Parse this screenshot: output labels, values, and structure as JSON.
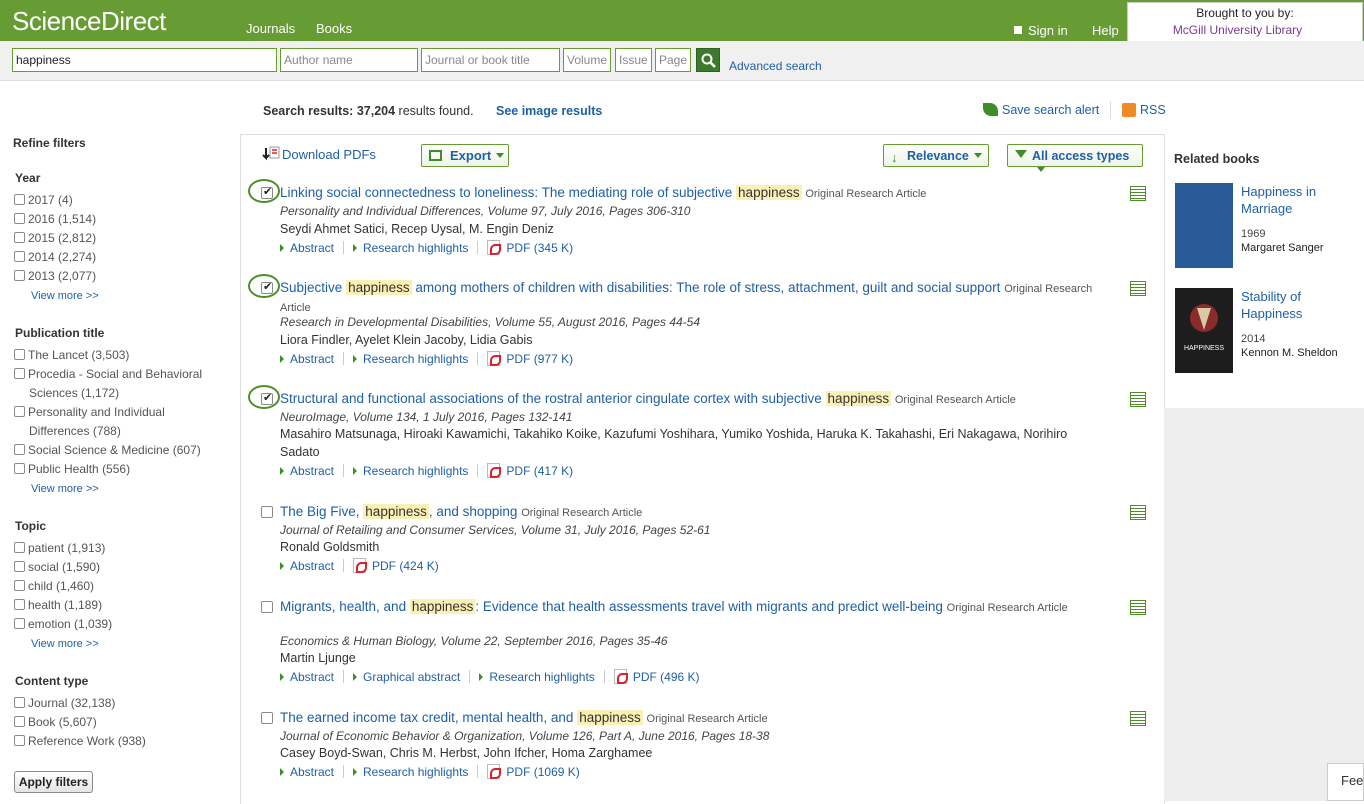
{
  "header": {
    "logo": "ScienceDirect",
    "nav": [
      "Journals",
      "Books"
    ],
    "sign_in": "Sign in",
    "help": "Help",
    "brought_label": "Brought to you by:",
    "brought_lib": "McGill University Library"
  },
  "search": {
    "query": "happiness",
    "author_placeholder": "Author name",
    "journal_placeholder": "Journal or book title",
    "volume_placeholder": "Volume",
    "issue_placeholder": "Issue",
    "page_placeholder": "Page",
    "advanced": "Advanced search"
  },
  "results_bar": {
    "label": "Search results:",
    "count": "37,204",
    "suffix": "results found.",
    "see_images": "See image results",
    "save_alert": "Save search alert",
    "rss": "RSS"
  },
  "toolbar": {
    "download": "Download PDFs",
    "export": "Export",
    "relevance": "Relevance",
    "access": "All access types"
  },
  "filters": {
    "title": "Refine filters",
    "year": {
      "title": "Year",
      "items": [
        {
          "label": "2017",
          "count": "(4)"
        },
        {
          "label": "2016",
          "count": "(1,514)"
        },
        {
          "label": "2015",
          "count": "(2,812)"
        },
        {
          "label": "2014",
          "count": "(2,274)"
        },
        {
          "label": "2013",
          "count": "(2,077)"
        }
      ],
      "more": "View more >>"
    },
    "publication": {
      "title": "Publication title",
      "items": [
        {
          "label": "The Lancet",
          "count": "(3,503)"
        },
        {
          "label": "Procedia - Social and Behavioral",
          "label2": "Sciences",
          "count": "(1,172)"
        },
        {
          "label": "Personality and Individual",
          "label2": "Differences",
          "count": "(788)"
        },
        {
          "label": "Social Science & Medicine",
          "count": "(607)"
        },
        {
          "label": "Public Health",
          "count": "(556)"
        }
      ],
      "more": "View more >>"
    },
    "topic": {
      "title": "Topic",
      "items": [
        {
          "label": "patient",
          "count": "(1,913)"
        },
        {
          "label": "social",
          "count": "(1,590)"
        },
        {
          "label": "child",
          "count": "(1,460)"
        },
        {
          "label": "health",
          "count": "(1,189)"
        },
        {
          "label": "emotion",
          "count": "(1,039)"
        }
      ],
      "more": "View more >>"
    },
    "content": {
      "title": "Content type",
      "items": [
        {
          "label": "Journal",
          "count": "(32,138)"
        },
        {
          "label": "Book",
          "count": "(5,607)"
        },
        {
          "label": "Reference Work",
          "count": "(938)"
        }
      ]
    },
    "apply": "Apply filters"
  },
  "results": [
    {
      "title_pre": "Linking social connectedness to loneliness: The mediating role of subjective",
      "highlight": "happiness",
      "title_post": "",
      "type": "Original Research Article",
      "source": "Personality and Individual Differences, Volume 97, July 2016, Pages 306-310",
      "authors": "Seydi Ahmet Satici, Recep Uysal, M. Engin Deniz",
      "links": [
        "Abstract",
        "Research highlights"
      ],
      "pdf": "PDF (345 K)"
    },
    {
      "title_pre": "Subjective",
      "highlight": "happiness",
      "title_post": "among mothers of children with disabilities: The role of stress, attachment, guilt and social support",
      "type": "Original Research Article",
      "source": "Research in Developmental Disabilities, Volume 55, August 2016, Pages 44-54",
      "authors": "Liora Findler, Ayelet Klein Jacoby, Lidia Gabis",
      "links": [
        "Abstract",
        "Research highlights"
      ],
      "pdf": "PDF (977 K)"
    },
    {
      "title_pre": "Structural and functional associations of the rostral anterior cingulate cortex with subjective",
      "highlight": "happiness",
      "title_post": "",
      "type": "Original Research Article",
      "source": "NeuroImage, Volume 134, 1 July 2016, Pages 132-141",
      "authors": "Masahiro Matsunaga, Hiroaki Kawamichi, Takahiko Koike, Kazufumi Yoshihara, Yumiko Yoshida, Haruka K. Takahashi, Eri Nakagawa, Norihiro Sadato",
      "links": [
        "Abstract",
        "Research highlights"
      ],
      "pdf": "PDF (417 K)"
    },
    {
      "title_pre": "The Big Five,",
      "highlight": "happiness",
      "title_post": ", and shopping",
      "type": "Original Research Article",
      "source": "Journal of Retailing and Consumer Services, Volume 31, July 2016, Pages 52-61",
      "authors": "Ronald Goldsmith",
      "links": [
        "Abstract"
      ],
      "pdf": "PDF (424 K)"
    },
    {
      "title_pre": "Migrants, health, and",
      "highlight": "happiness",
      "title_post": ": Evidence that health assessments travel with migrants and predict well-being",
      "type": "Original Research Article",
      "source": "Economics & Human Biology, Volume 22, September 2016, Pages 35-46",
      "authors": "Martin Ljunge",
      "links": [
        "Abstract",
        "Graphical abstract",
        "Research highlights"
      ],
      "pdf": "PDF (496 K)"
    },
    {
      "title_pre": "The earned income tax credit, mental health, and",
      "highlight": "happiness",
      "title_post": "",
      "type": "Original Research Article",
      "source": "Journal of Economic Behavior & Organization, Volume 126, Part A, June 2016, Pages 18-38",
      "authors": "Casey Boyd-Swan, Chris M. Herbst, John Ifcher, Homa Zarghamee",
      "links": [
        "Abstract",
        "Research highlights"
      ],
      "pdf": "PDF (1069 K)"
    }
  ],
  "related": {
    "title": "Related books",
    "books": [
      {
        "title": "Happiness in Marriage",
        "year": "1969",
        "author": "Margaret Sanger",
        "cover_color": "#2a5b99"
      },
      {
        "title": "Stability of Happiness",
        "year": "2014",
        "author": "Kennon M. Sheldon",
        "cover_color": "#1d1d1d",
        "cover_text": "HAPPINESS"
      }
    ]
  },
  "feedback": "Fee"
}
